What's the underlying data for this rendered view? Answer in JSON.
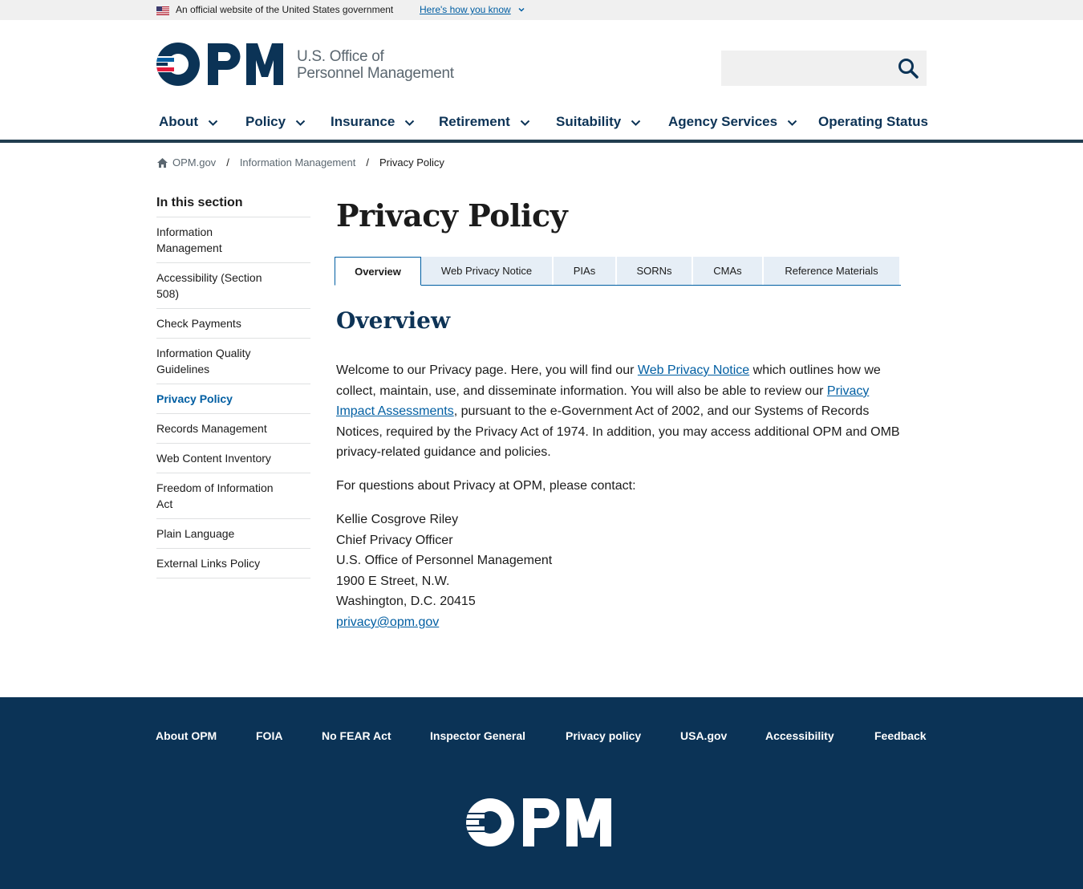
{
  "gov_banner": {
    "official_text": "An official website of the United States government",
    "how_you_know": "Here's how you know"
  },
  "header": {
    "logo_text": "OPM",
    "logo_subtitle_line1": "U.S. Office of",
    "logo_subtitle_line2": "Personnel Management",
    "search_placeholder": "",
    "colors": {
      "navy": "#0b3356",
      "red": "#e31c3d",
      "accent_blue": "#005ea2"
    }
  },
  "main_nav": [
    {
      "label": "About",
      "has_dropdown": true
    },
    {
      "label": "Policy",
      "has_dropdown": true
    },
    {
      "label": "Insurance",
      "has_dropdown": true
    },
    {
      "label": "Retirement",
      "has_dropdown": true
    },
    {
      "label": "Suitability",
      "has_dropdown": true
    },
    {
      "label": "Agency Services",
      "has_dropdown": true
    },
    {
      "label": "Operating Status",
      "has_dropdown": false
    }
  ],
  "breadcrumb": {
    "home": "OPM.gov",
    "level1": "Information Management",
    "current": "Privacy Policy"
  },
  "sidenav": {
    "title": "In this section",
    "items": [
      {
        "label": "Information Management",
        "active": false
      },
      {
        "label": "Accessibility (Section 508)",
        "active": false
      },
      {
        "label": "Check Payments",
        "active": false
      },
      {
        "label": "Information Quality Guidelines",
        "active": false
      },
      {
        "label": "Privacy Policy",
        "active": true
      },
      {
        "label": "Records Management",
        "active": false
      },
      {
        "label": "Web Content Inventory",
        "active": false
      },
      {
        "label": "Freedom of Information Act",
        "active": false
      },
      {
        "label": "Plain Language",
        "active": false
      },
      {
        "label": "External Links Policy",
        "active": false
      }
    ]
  },
  "content": {
    "page_title": "Privacy Policy",
    "tabs": [
      {
        "label": "Overview",
        "active": true
      },
      {
        "label": "Web Privacy Notice",
        "active": false
      },
      {
        "label": "PIAs",
        "active": false
      },
      {
        "label": "SORNs",
        "active": false
      },
      {
        "label": "CMAs",
        "active": false
      },
      {
        "label": "Reference Materials",
        "active": false
      }
    ],
    "section_heading": "Overview",
    "intro_1": "Welcome to our Privacy page.  Here, you will find our ",
    "link_web_privacy": "Web Privacy Notice",
    "intro_2": " which outlines how we collect, maintain, use, and disseminate information.  You will also be able to review our ",
    "link_pia": "Privacy Impact Assessments",
    "intro_3": ", pursuant to the e-Government Act of 2002, and our Systems of Records Notices, required by the Privacy Act of 1974.  In addition, you may access additional OPM and OMB privacy-related guidance and policies.",
    "questions": "For questions about Privacy at OPM, please contact:",
    "contact_name": "Kellie Cosgrove Riley",
    "contact_title": "Chief Privacy Officer",
    "contact_org": "U.S. Office of Personnel Management",
    "contact_street": "1900 E Street, N.W.",
    "contact_city": "Washington, D.C.  20415",
    "contact_email": "privacy@opm.gov"
  },
  "footer": {
    "links": [
      "About OPM",
      "FOIA",
      "No FEAR Act",
      "Inspector General",
      "Privacy policy",
      "USA.gov",
      "Accessibility",
      "Feedback"
    ],
    "logo_text": "OPM"
  }
}
